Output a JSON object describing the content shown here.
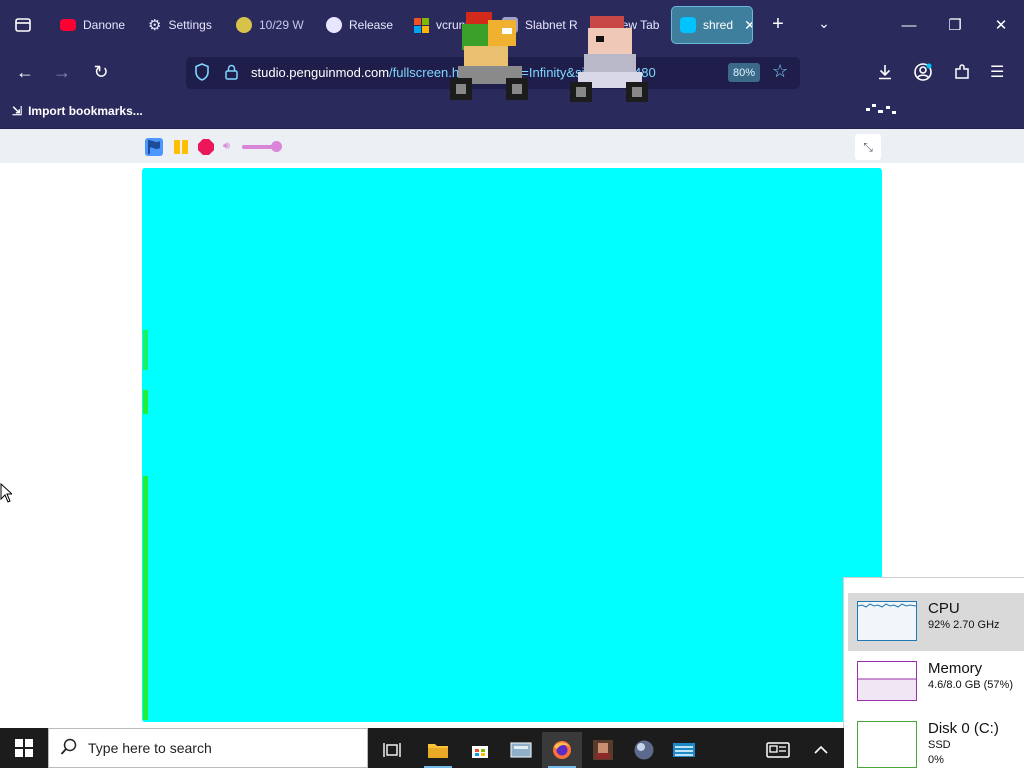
{
  "browser": {
    "tabs": [
      {
        "label": "Danone",
        "icon": "youtube-icon",
        "color": "#ff0033"
      },
      {
        "label": "Settings",
        "icon": "gear-icon",
        "color": "#e8e6ff"
      },
      {
        "label": "10/29 W",
        "icon": "pencil-icon",
        "color": "#d8c34a"
      },
      {
        "label": "Release",
        "icon": "github-icon",
        "color": "#e8e6ff"
      },
      {
        "label": "vcrunt",
        "icon": "microsoft-icon",
        "color": "#f25022"
      },
      {
        "label": "Slabnet R",
        "icon": "page-icon",
        "color": "#a0a0c8"
      },
      {
        "label": "New Tab",
        "icon": "firefox-icon",
        "color": "#ff7139"
      },
      {
        "label": "shred",
        "icon": "penguinmod-icon",
        "color": "#00c3ff",
        "active": true
      }
    ],
    "url": {
      "host": "studio.penguinmod.com",
      "path": "/fullscreen.html?clones=Infinity&size=640x480",
      "zoom": "80%"
    },
    "bookmarks_label": "Import bookmarks..."
  },
  "player": {
    "stage_color": "#00ffff",
    "volume_level": 1.0
  },
  "task_manager": {
    "cpu": {
      "title": "CPU",
      "detail": "92%  2.70 GHz",
      "color": "#1f77b4"
    },
    "memory": {
      "title": "Memory",
      "detail": "4.6/8.0 GB (57%)",
      "color": "#9b2fae"
    },
    "disk": {
      "title": "Disk 0 (C:)",
      "type": "SSD",
      "usage": "0%",
      "color": "#4aa53a"
    }
  },
  "taskbar": {
    "search_placeholder": "Type here to search"
  }
}
